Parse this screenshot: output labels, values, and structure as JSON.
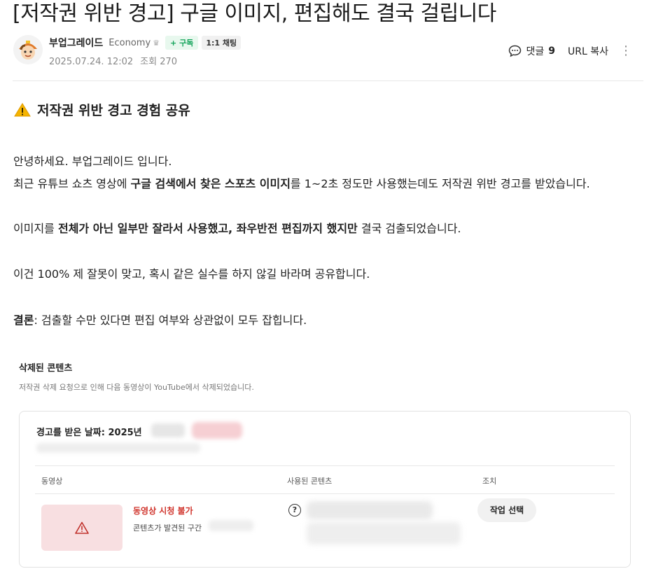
{
  "post": {
    "title": "[저작권 위반 경고] 구글 이미지, 편집해도 결국 걸립니다",
    "author": "부업그레이드",
    "grade": "Economy",
    "subscribe_label": "+ 구독",
    "chat_label": "1:1 채팅",
    "date": "2025.07.24. 12:02",
    "views_label": "조회 270",
    "comments_label": "댓글",
    "comments_count": "9",
    "url_copy_label": "URL 복사"
  },
  "content": {
    "section_heading": "저작권 위반 경고 경험 공유",
    "greeting": "안녕하세요. 부업그레이드 입니다.",
    "p2": {
      "before": "최근 유튜브 쇼츠 영상에 ",
      "bold": "구글 검색에서 찾은 스포츠 이미지",
      "after": "를 1~2초 정도만 사용했는데도 저작권 위반 경고를 받았습니다."
    },
    "p3": {
      "before": "이미지를 ",
      "bold": "전체가 아닌 일부만 잘라서 사용했고, 좌우반전 편집까지 했지만",
      "after": " 결국 검출되었습니다."
    },
    "p4": "이건 100% 제 잘못이 맞고, 혹시 같은 실수를 하지 않길 바라며 공유합니다.",
    "p5": {
      "bold": "결론",
      "after": ": 검출할 수만 있다면 편집 여부와 상관없이 모두 잡힙니다."
    }
  },
  "screenshot": {
    "title": "삭제된 콘텐츠",
    "description": "저작권 삭제 요청으로 인해 다음 동영상이 YouTube에서 삭제되었습니다.",
    "warning_date_label": "경고를 받은 날짜: 2025년",
    "columns": [
      "동영상",
      "사용된 콘텐츠",
      "조치"
    ],
    "video_status": "동영상 시청 불가",
    "found_section_label": "콘텐츠가 발견된 구간",
    "action_button": "작업 선택"
  }
}
